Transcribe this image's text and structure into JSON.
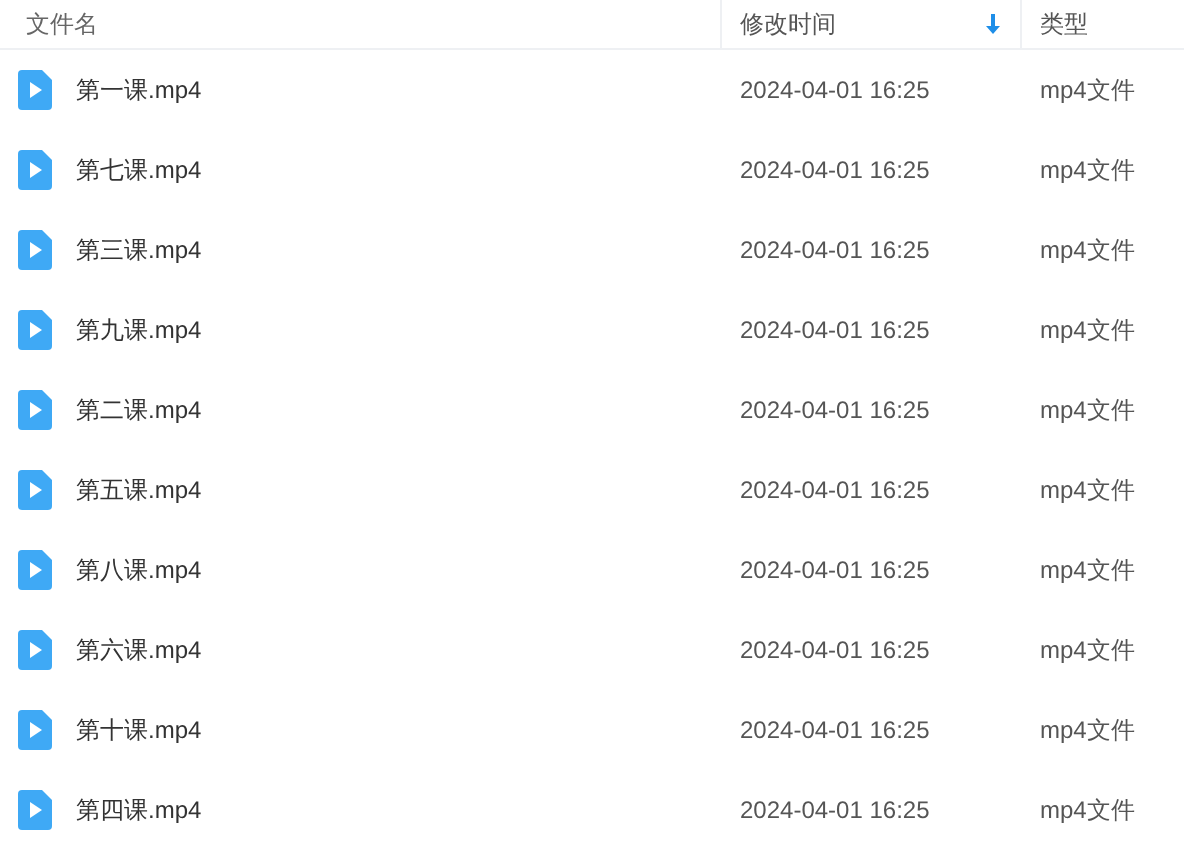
{
  "table": {
    "columns": [
      {
        "label": "文件名",
        "sorted": false
      },
      {
        "label": "修改时间",
        "sorted": true
      },
      {
        "label": "类型",
        "sorted": false
      }
    ],
    "rows": [
      {
        "name": "第一课.mp4",
        "modified": "2024-04-01 16:25",
        "type": "mp4文件"
      },
      {
        "name": "第七课.mp4",
        "modified": "2024-04-01 16:25",
        "type": "mp4文件"
      },
      {
        "name": "第三课.mp4",
        "modified": "2024-04-01 16:25",
        "type": "mp4文件"
      },
      {
        "name": "第九课.mp4",
        "modified": "2024-04-01 16:25",
        "type": "mp4文件"
      },
      {
        "name": "第二课.mp4",
        "modified": "2024-04-01 16:25",
        "type": "mp4文件"
      },
      {
        "name": "第五课.mp4",
        "modified": "2024-04-01 16:25",
        "type": "mp4文件"
      },
      {
        "name": "第八课.mp4",
        "modified": "2024-04-01 16:25",
        "type": "mp4文件"
      },
      {
        "name": "第六课.mp4",
        "modified": "2024-04-01 16:25",
        "type": "mp4文件"
      },
      {
        "name": "第十课.mp4",
        "modified": "2024-04-01 16:25",
        "type": "mp4文件"
      },
      {
        "name": "第四课.mp4",
        "modified": "2024-04-01 16:25",
        "type": "mp4文件"
      }
    ]
  }
}
